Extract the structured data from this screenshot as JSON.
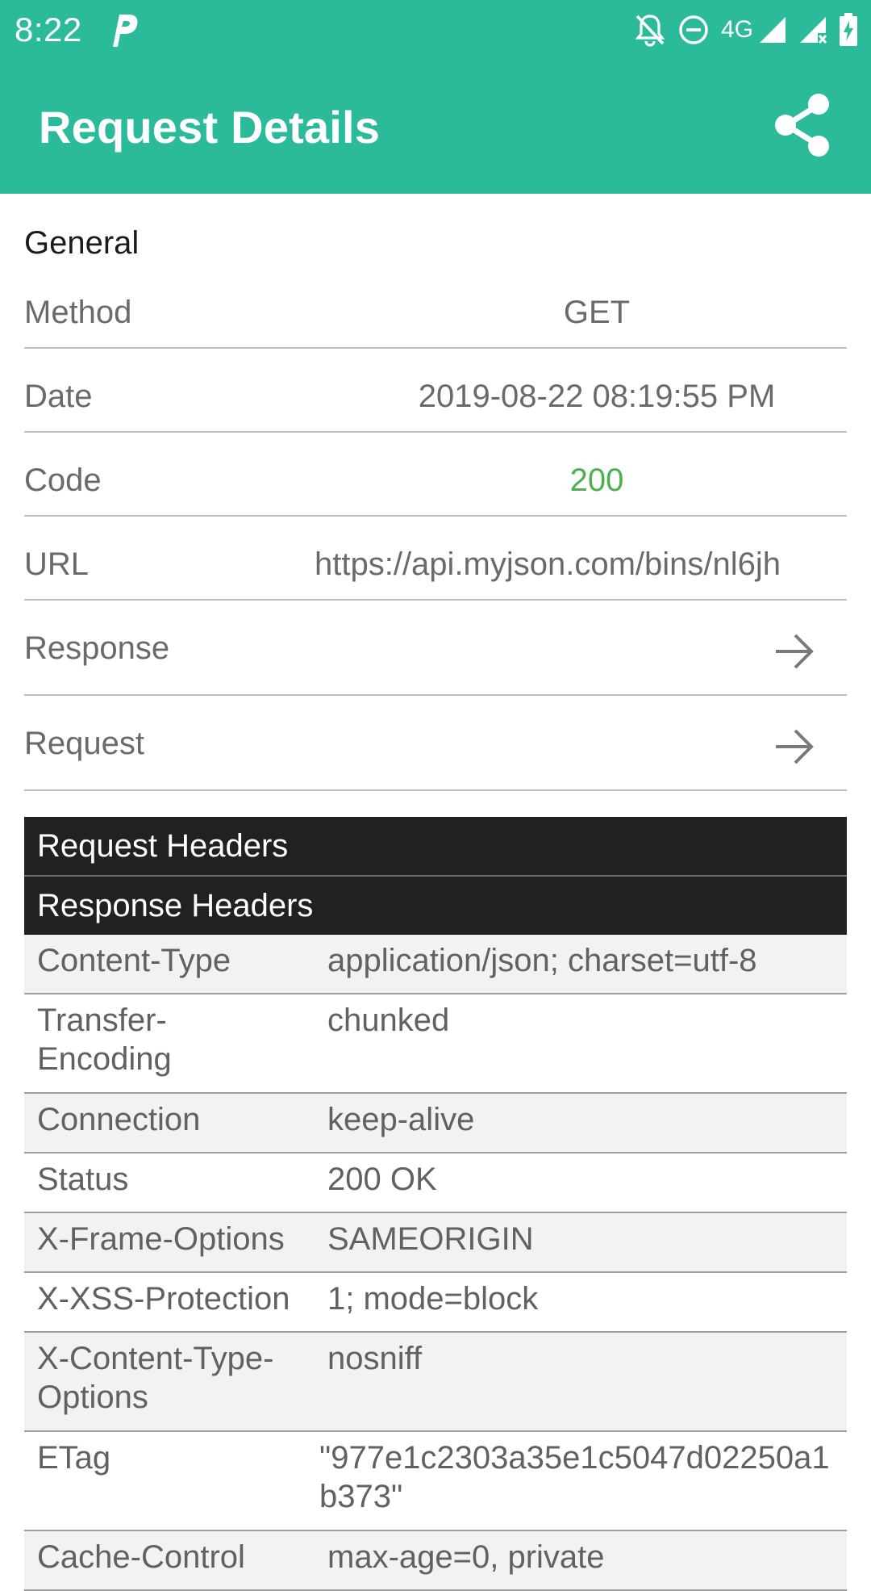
{
  "status_bar": {
    "time": "8:22",
    "network": "4G",
    "icons": [
      "parking-app-icon",
      "notifications-off-icon",
      "do-not-disturb-icon",
      "signal-icon",
      "signal-no-data-icon",
      "battery-charging-icon"
    ]
  },
  "app_bar": {
    "title": "Request Details",
    "share_icon": "share-icon",
    "color": "#2bbb9b"
  },
  "general": {
    "title": "General",
    "rows": [
      {
        "label": "Method",
        "value": "GET"
      },
      {
        "label": "Date",
        "value": "2019-08-22 08:19:55 PM"
      },
      {
        "label": "Code",
        "value": "200",
        "value_color": "#4caf50"
      },
      {
        "label": "URL",
        "value": "https://api.myjson.com/bins/nl6jh"
      }
    ],
    "links": [
      {
        "label": "Response",
        "icon": "arrow-right-icon"
      },
      {
        "label": "Request",
        "icon": "arrow-right-icon"
      }
    ]
  },
  "request_headers": {
    "title": "Request Headers"
  },
  "response_headers": {
    "title": "Response Headers",
    "rows": [
      {
        "key": "Content-Type",
        "value": "application/json; charset=utf-8"
      },
      {
        "key": "Transfer-Encoding",
        "value": "chunked"
      },
      {
        "key": "Connection",
        "value": "keep-alive"
      },
      {
        "key": "Status",
        "value": "200 OK"
      },
      {
        "key": "X-Frame-Options",
        "value": "SAMEORIGIN"
      },
      {
        "key": "X-XSS-Protection",
        "value": "1; mode=block"
      },
      {
        "key": "X-Content-Type-Options",
        "value": "nosniff"
      },
      {
        "key": "ETag",
        "value": "\"977e1c2303a35e1c5047d02250a1b373\""
      },
      {
        "key": "Cache-Control",
        "value": "max-age=0, private"
      }
    ]
  }
}
